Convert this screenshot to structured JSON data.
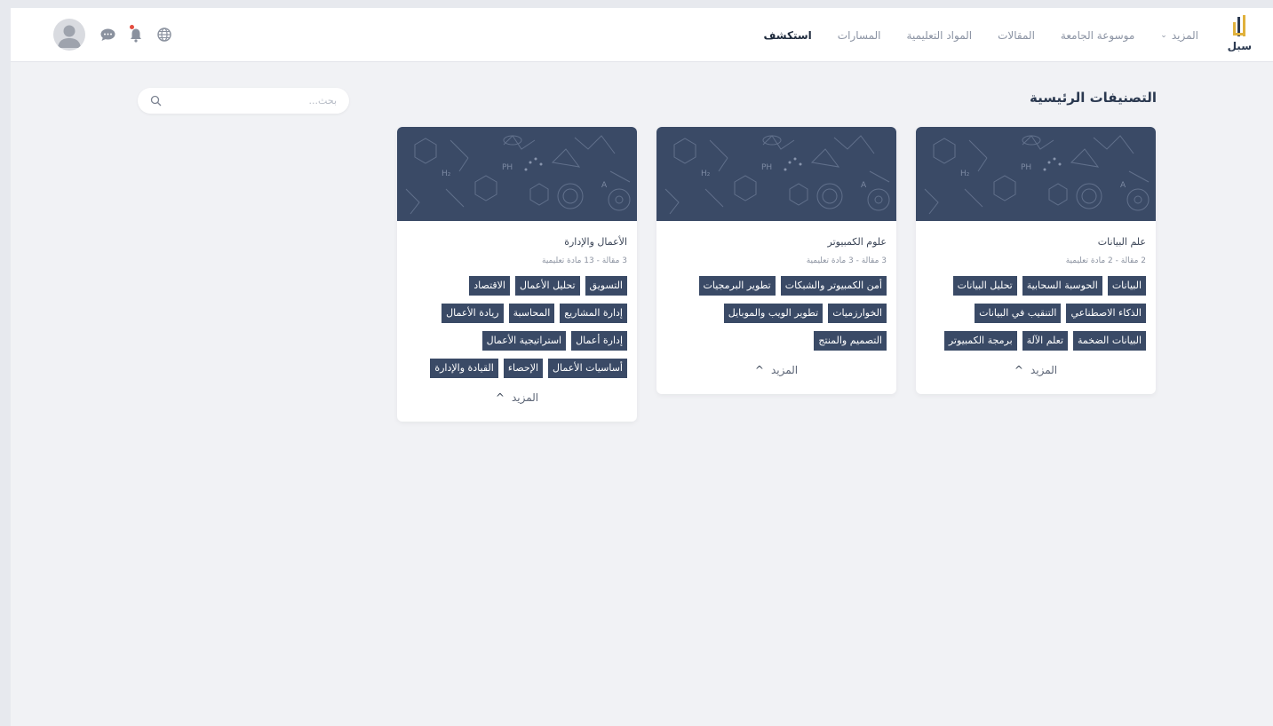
{
  "app": {
    "logo_text": "سبل"
  },
  "nav": {
    "items": [
      {
        "label": "استكشف",
        "active": true
      },
      {
        "label": "المسارات"
      },
      {
        "label": "المواد التعليمية"
      },
      {
        "label": "المقالات"
      },
      {
        "label": "موسوعة الجامعة"
      },
      {
        "label": "المزيد"
      }
    ]
  },
  "header_icons": [
    "globe-icon",
    "bell-icon",
    "chat-icon",
    "user-avatar"
  ],
  "page": {
    "title": "التصنيفات الرئيسية",
    "search_placeholder": "بحث..."
  },
  "cards": [
    {
      "title": "علم البيانات",
      "meta": "2 مقالة - 2 مادة تعليمية",
      "tags": [
        "البيانات",
        "الحوسبة السحابية",
        "تحليل البيانات",
        "الذكاء الاصطناعي",
        "التنقيب في البيانات",
        "البيانات الضخمة",
        "تعلم الآلة",
        "برمجة الكمبيوتر"
      ],
      "more_label": "المزيد"
    },
    {
      "title": "علوم الكمبيوتر",
      "meta": "3 مقالة - 3 مادة تعليمية",
      "tags": [
        "أمن الكمبيوتر والشبكات",
        "تطوير البرمجيات",
        "الخوارزميات",
        "تطوير الويب والموبايل",
        "التصميم والمنتج"
      ],
      "more_label": "المزيد"
    },
    {
      "title": "الأعمال والإدارة",
      "meta": "3 مقالة - 13 مادة تعليمية",
      "tags": [
        "التسويق",
        "تحليل الأعمال",
        "الاقتصاد",
        "إدارة المشاريع",
        "المحاسبة",
        "ريادة الأعمال",
        "إدارة أعمال",
        "استراتيجية الأعمال",
        "أساسيات الأعمال",
        "الإحصاء",
        "القيادة والإدارة"
      ],
      "more_label": "المزيد"
    }
  ],
  "colors": {
    "accent": "#3a4a66",
    "background": "#f1f2f5",
    "notification": "#e44d3f"
  }
}
